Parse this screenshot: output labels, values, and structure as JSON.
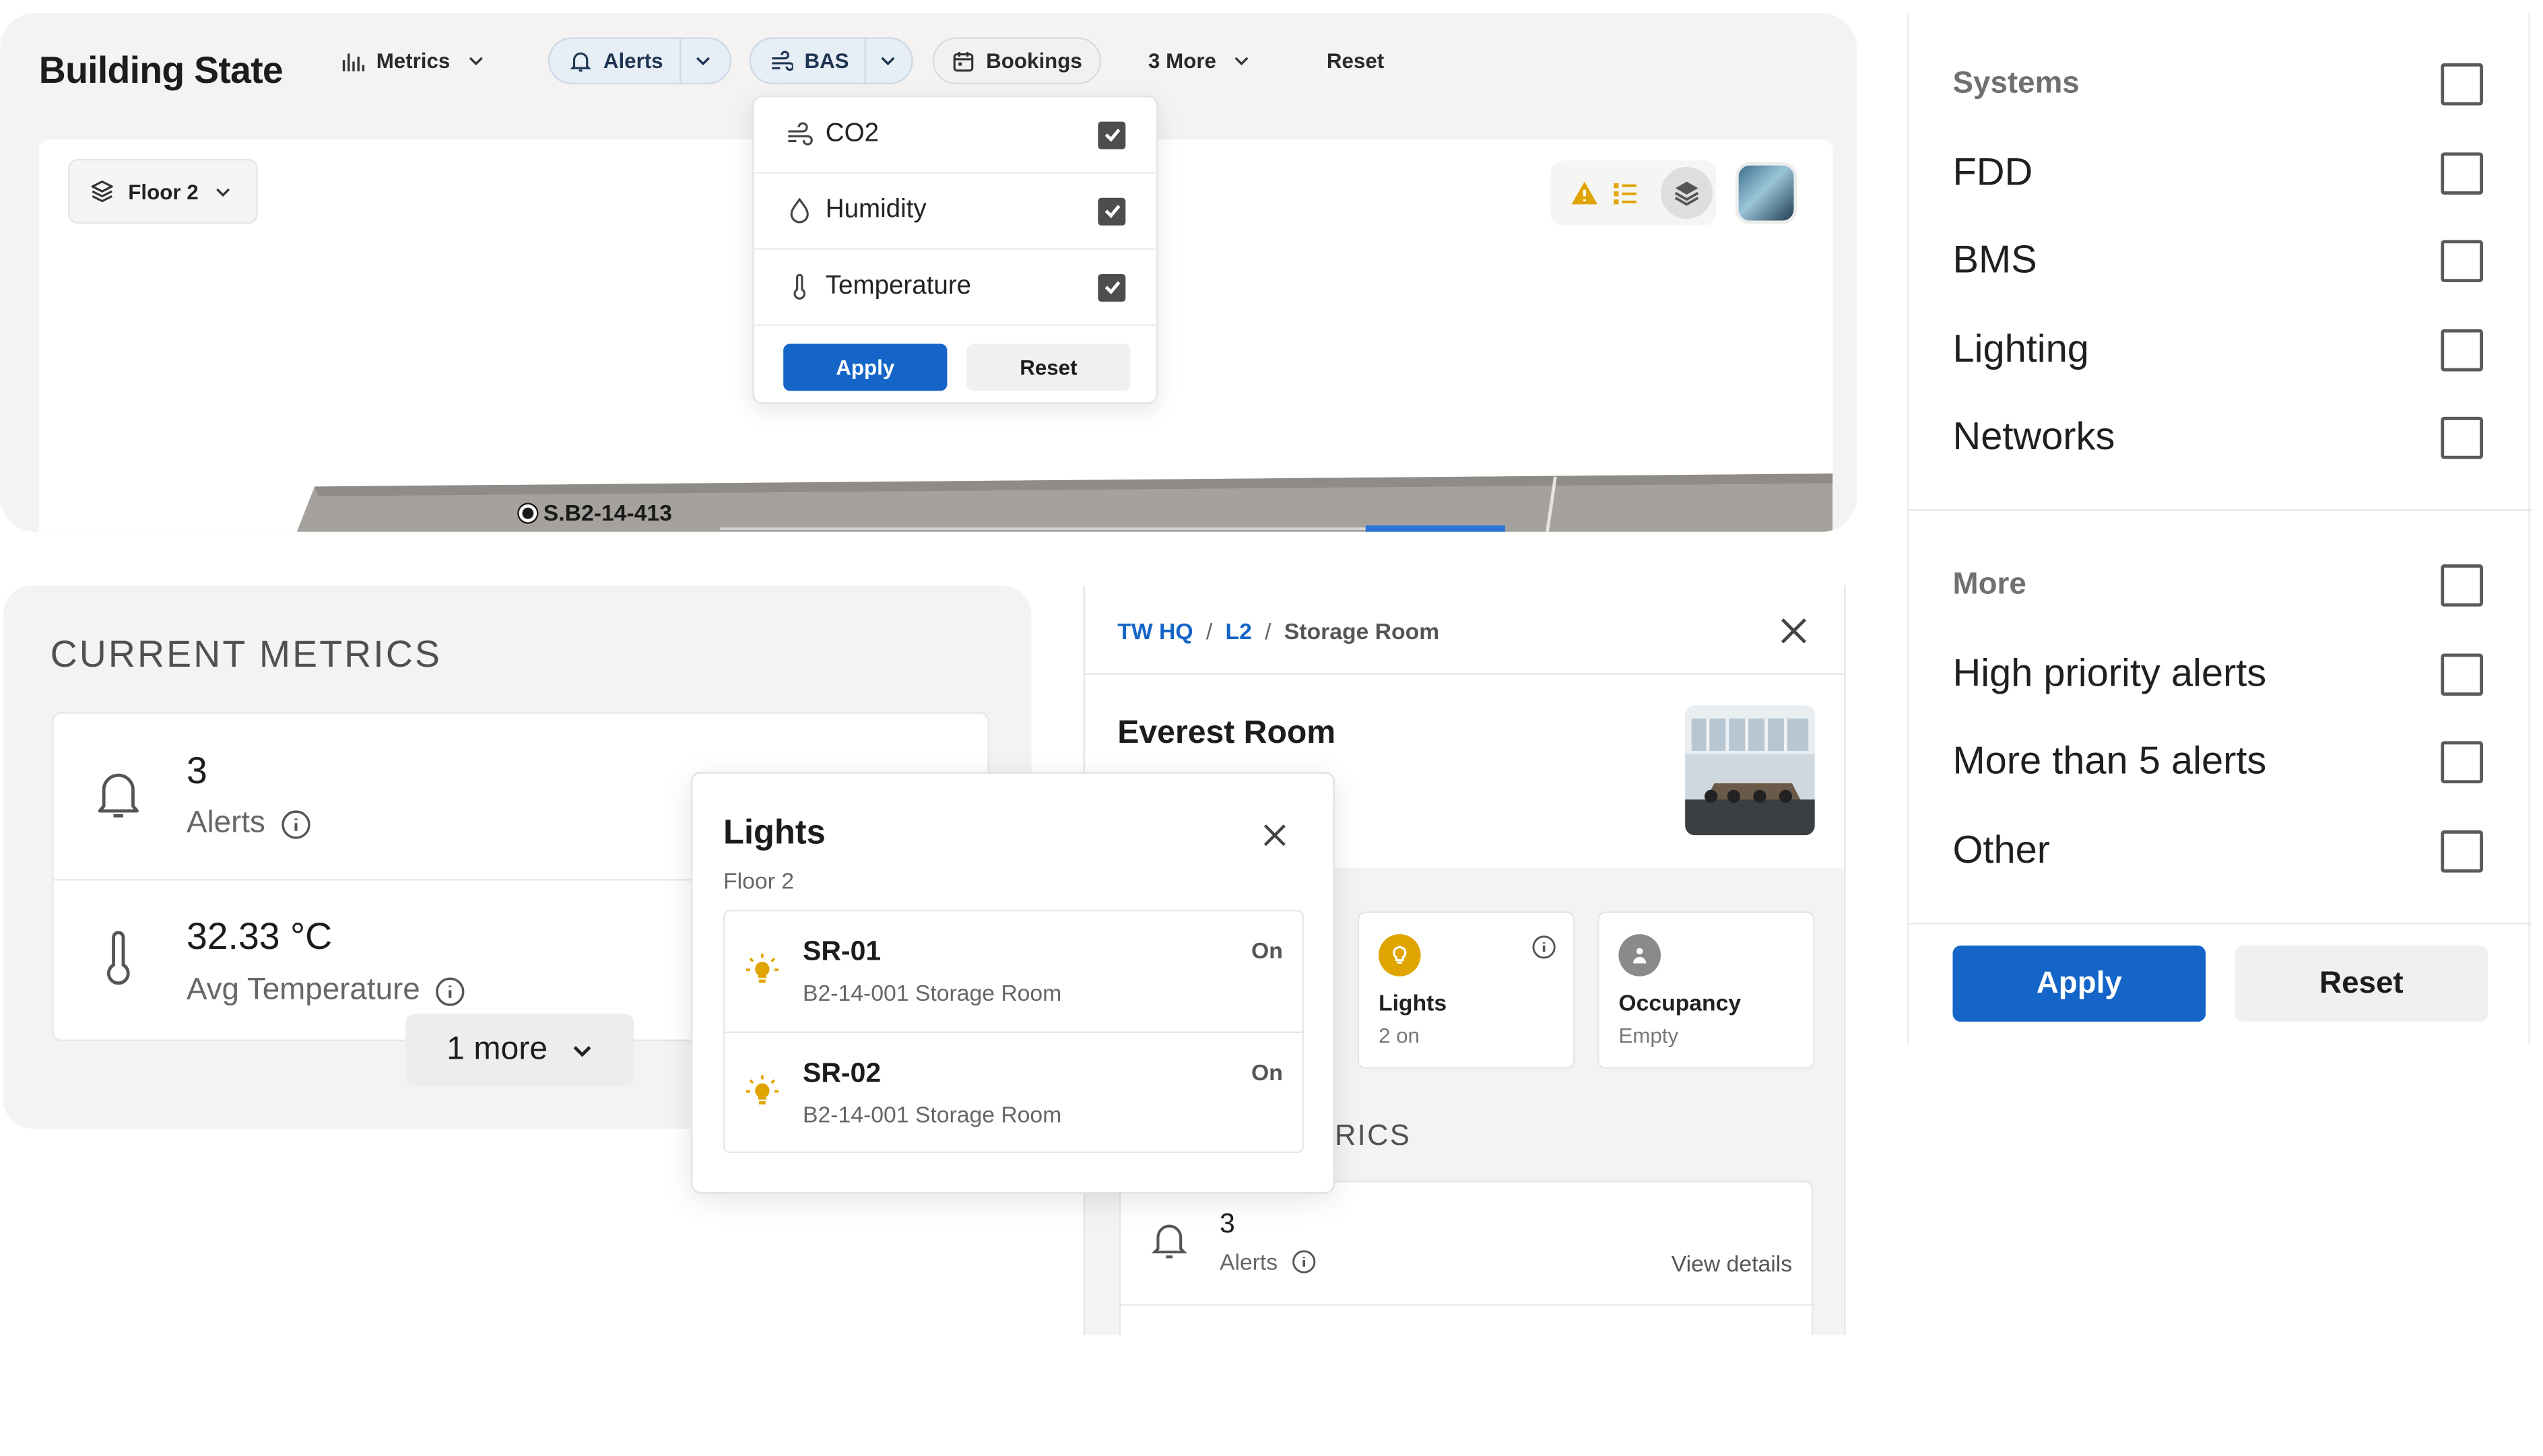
{
  "header": {
    "title": "Building State",
    "metrics_label": "Metrics",
    "alerts_label": "Alerts",
    "bas_label": "BAS",
    "bookings_label": "Bookings",
    "more_label": "3 More",
    "reset_label": "Reset"
  },
  "map": {
    "floor_label": "Floor 2",
    "room_label": "S.B2-14-413"
  },
  "bas_dropdown": {
    "items": [
      {
        "label": "CO2",
        "checked": true
      },
      {
        "label": "Humidity",
        "checked": true
      },
      {
        "label": "Temperature",
        "checked": true
      }
    ],
    "apply_label": "Apply",
    "reset_label": "Reset"
  },
  "filter": {
    "systems_heading": "Systems",
    "systems": [
      "FDD",
      "BMS",
      "Lighting",
      "Networks"
    ],
    "more_heading": "More",
    "more": [
      "High priority alerts",
      "More than 5 alerts",
      "Other"
    ],
    "apply_label": "Apply",
    "reset_label": "Reset"
  },
  "metrics": {
    "title": "CURRENT METRICS",
    "alerts_value": "3",
    "alerts_label": "Alerts",
    "temp_value": "32.33 °C",
    "temp_label": "Avg Temperature",
    "more_label": "1 more"
  },
  "room": {
    "crumb_site": "TW HQ",
    "crumb_floor": "L2",
    "crumb_room": "Storage Room",
    "name": "Everest Room",
    "lights_tile_name": "Lights",
    "lights_tile_sub": "2 on",
    "occupancy_tile_name": "Occupancy",
    "occupancy_tile_sub": "Empty",
    "section_partial": "RICS",
    "alerts_value": "3",
    "alerts_label": "Alerts",
    "view_details": "View details"
  },
  "lights_popup": {
    "title": "Lights",
    "subtitle": "Floor 2",
    "items": [
      {
        "name": "SR-01",
        "location": "B2-14-001 Storage Room",
        "status": "On"
      },
      {
        "name": "SR-02",
        "location": "B2-14-001 Storage Room",
        "status": "On"
      }
    ]
  },
  "colors": {
    "accent_blue": "#1565c8",
    "warning_yellow": "#e0a400",
    "panel_bg": "#f4f3f1"
  }
}
